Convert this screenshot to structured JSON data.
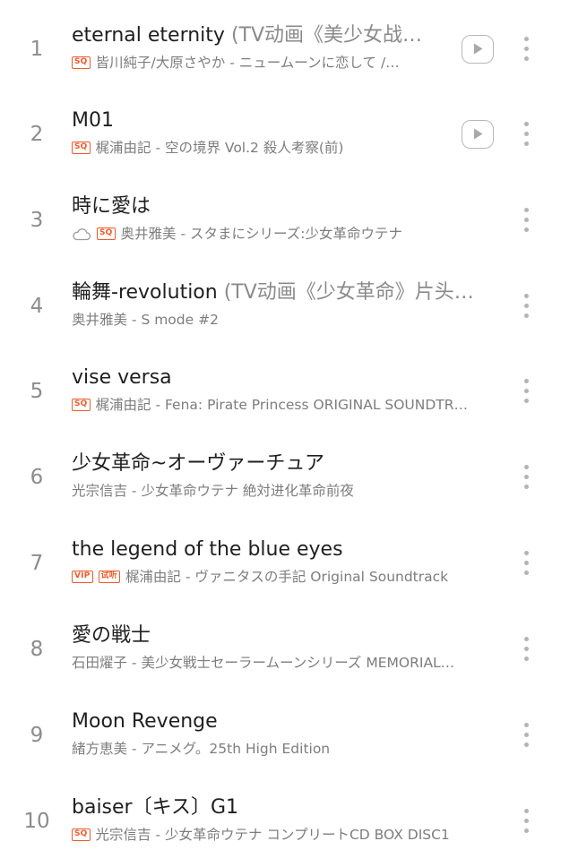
{
  "songs": [
    {
      "index": "1",
      "title": "eternal eternity",
      "subtitle": " (TV动画《美少女战…",
      "badges": [
        "SQ"
      ],
      "meta": "皆川純子/大原さやか - ニュームーンに恋して /…",
      "has_play": true
    },
    {
      "index": "2",
      "title": "M01",
      "subtitle": "",
      "badges": [
        "SQ"
      ],
      "meta": "梶浦由記 - 空の境界 Vol.2 殺人考察(前)",
      "has_play": true
    },
    {
      "index": "3",
      "title": "時に愛は",
      "subtitle": "",
      "badges": [
        "cloud",
        "SQ"
      ],
      "meta": "奥井雅美 - スタまにシリーズ:少女革命ウテナ",
      "has_play": false
    },
    {
      "index": "4",
      "title": "輪舞-revolution",
      "subtitle": " (TV动画《少女革命》片头…",
      "badges": [],
      "meta": "奥井雅美 - S mode #2",
      "has_play": false
    },
    {
      "index": "5",
      "title": "vise versa",
      "subtitle": "",
      "badges": [
        "SQ"
      ],
      "meta": "梶浦由記 - Fena: Pirate Princess ORIGINAL SOUNDTR…",
      "has_play": false
    },
    {
      "index": "6",
      "title": "少女革命~オーヴァーチュア",
      "subtitle": "",
      "badges": [],
      "meta": "光宗信吉 - 少女革命ウテナ 絶対进化革命前夜",
      "has_play": false
    },
    {
      "index": "7",
      "title": "the legend of the blue eyes",
      "subtitle": "",
      "badges": [
        "VIP",
        "试听"
      ],
      "meta": "梶浦由記 - ヴァニタスの手記 Original Soundtrack",
      "has_play": false
    },
    {
      "index": "8",
      "title": "愛の戦士",
      "subtitle": "",
      "badges": [],
      "meta": "石田燿子 - 美少女戦士セーラームーンシリーズ MEMORIAL…",
      "has_play": false
    },
    {
      "index": "9",
      "title": "Moon Revenge",
      "subtitle": "",
      "badges": [],
      "meta": "緒方恵美 - アニメグ。25th High Edition",
      "has_play": false
    },
    {
      "index": "10",
      "title": "baiser〔キス〕G1",
      "subtitle": "",
      "badges": [
        "SQ"
      ],
      "meta": "光宗信吉 - 少女革命ウテナ コンプリートCD BOX DISC1",
      "has_play": false
    }
  ],
  "icons": {
    "play": "play-icon",
    "more": "more-vertical-icon",
    "cloud": "cloud-icon"
  },
  "colors": {
    "badge": "#ee5a2c",
    "title": "#1f1f1f",
    "meta": "#7d7d7d",
    "icon": "#b4b4b4"
  }
}
